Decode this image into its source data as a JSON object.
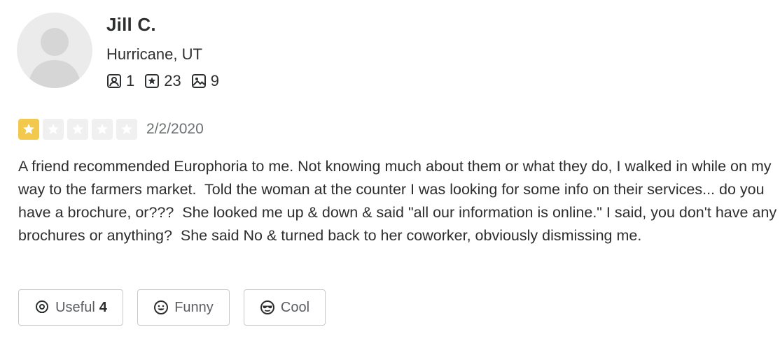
{
  "user": {
    "name": "Jill C.",
    "location": "Hurricane, UT",
    "stats": {
      "friends": "1",
      "reviews": "23",
      "photos": "9"
    },
    "icons": {
      "avatar": "default-avatar-silhouette",
      "friends": "friends-icon",
      "reviews": "review-star-icon",
      "photos": "photo-icon"
    }
  },
  "review": {
    "rating": 1,
    "max_rating": 5,
    "date": "2/2/2020",
    "text": "A friend recommended Europhoria to me. Not knowing much about them or what they do, I walked in while on my way to the farmers market.  Told the woman at the counter I was looking for some info on their services... do you have a brochure, or???  She looked me up & down & said \"all our information is online.\" I said, you don't have any brochures or anything?  She said No & turned back to her coworker, obviously dismissing me."
  },
  "reactions": {
    "useful": {
      "label": "Useful",
      "count": "4",
      "icon": "lightbulb-icon"
    },
    "funny": {
      "label": "Funny",
      "icon": "smiley-icon"
    },
    "cool": {
      "label": "Cool",
      "icon": "sunglasses-face-icon"
    }
  },
  "colors": {
    "star_filled": "#f2c94c",
    "star_empty": "#f0f0f0",
    "text": "#2d2e2f",
    "muted": "#6e7072",
    "border": "#c9c9c9"
  }
}
